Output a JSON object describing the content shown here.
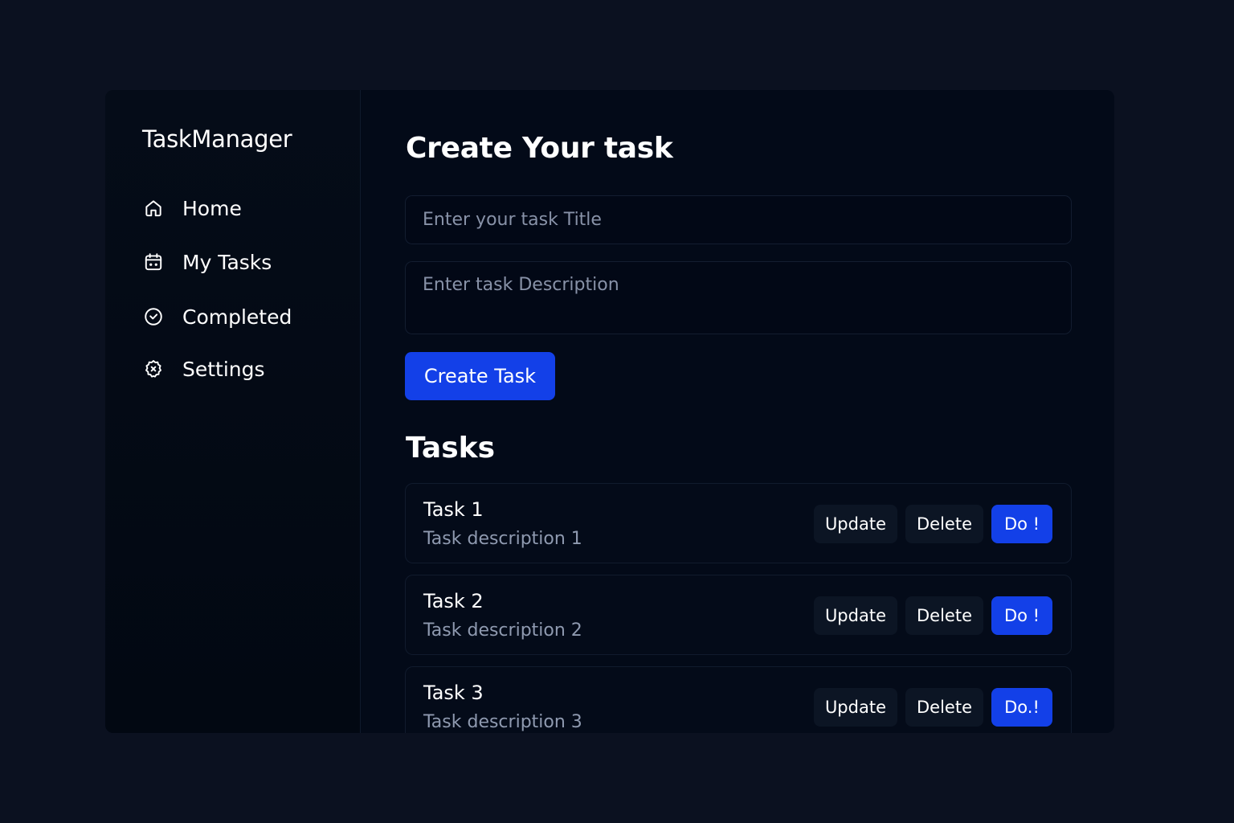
{
  "app": {
    "brand": "TaskManager"
  },
  "sidebar": {
    "items": [
      {
        "label": "Home",
        "icon": "home-icon"
      },
      {
        "label": "My Tasks",
        "icon": "calendar-icon"
      },
      {
        "label": "Completed",
        "icon": "check-circle-icon"
      },
      {
        "label": "Settings",
        "icon": "gear-icon"
      }
    ]
  },
  "form": {
    "heading": "Create Your task",
    "title_placeholder": "Enter your task Title",
    "title_value": "",
    "description_placeholder": "Enter task Description",
    "description_value": "",
    "submit_label": "Create Task"
  },
  "tasks": {
    "heading": "Tasks",
    "items": [
      {
        "title": "Task 1",
        "description": "Task description 1",
        "update_label": "Update",
        "delete_label": "Delete",
        "do_label": "Do !"
      },
      {
        "title": "Task 2",
        "description": "Task description 2",
        "update_label": "Update",
        "delete_label": "Delete",
        "do_label": "Do !"
      },
      {
        "title": "Task 3",
        "description": "Task description 3",
        "update_label": "Update",
        "delete_label": "Delete",
        "do_label": "Do.!"
      }
    ]
  },
  "colors": {
    "background": "#0b1120",
    "panel": "#030a18",
    "accent": "#1340e8",
    "secondary_button": "#0c1524",
    "muted_text": "#8f9ab0"
  }
}
